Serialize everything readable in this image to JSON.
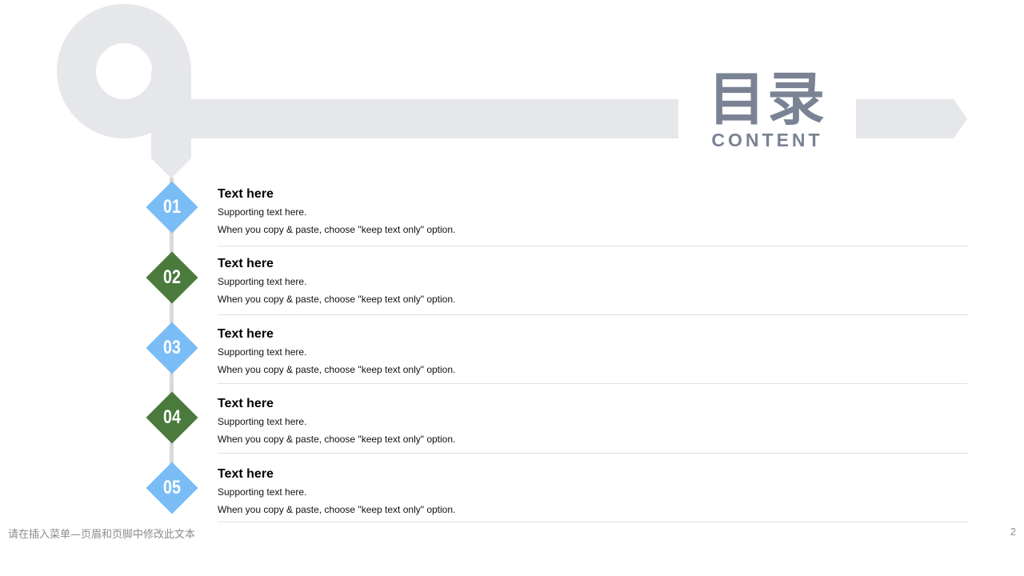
{
  "header": {
    "title_cn": "目录",
    "title_en": "CONTENT"
  },
  "colors": {
    "decor_gray": "#e6e7ea",
    "title_gray": "#7a8394",
    "blue": "#7abcf5",
    "green": "#4a7a3c"
  },
  "items": [
    {
      "number": "01",
      "title": "Text here",
      "subtitle": "Supporting text here.",
      "note": "When you copy & paste, choose \"keep text only\" option.",
      "color": "#7abcf5"
    },
    {
      "number": "02",
      "title": "Text here",
      "subtitle": "Supporting text here.",
      "note": "When you copy & paste, choose \"keep text only\" option.",
      "color": "#4a7a3c"
    },
    {
      "number": "03",
      "title": "Text here",
      "subtitle": "Supporting text here.",
      "note": "When you copy & paste, choose \"keep text only\" option.",
      "color": "#7abcf5"
    },
    {
      "number": "04",
      "title": "Text here",
      "subtitle": "Supporting text here.",
      "note": "When you copy & paste, choose \"keep text only\" option.",
      "color": "#4a7a3c"
    },
    {
      "number": "05",
      "title": "Text here",
      "subtitle": "Supporting text here.",
      "note": "When you copy & paste, choose \"keep text only\" option.",
      "color": "#7abcf5"
    }
  ],
  "footer": {
    "left_text": "请在插入菜单—页眉和页脚中修改此文本",
    "page_number": "2"
  }
}
